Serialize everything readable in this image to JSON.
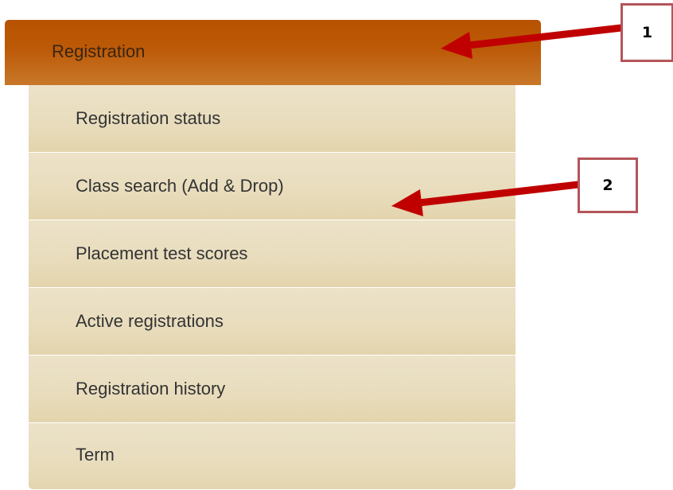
{
  "menu": {
    "header_label": "Registration",
    "items": [
      {
        "label": "Registration status"
      },
      {
        "label": "Class search (Add & Drop)"
      },
      {
        "label": "Placement test scores"
      },
      {
        "label": "Active registrations"
      },
      {
        "label": "Registration history"
      },
      {
        "label": "Term"
      }
    ]
  },
  "annotations": {
    "callout_1": "1",
    "callout_2": "2",
    "arrow_color": "#c00000",
    "box_border_color": "#b5555a"
  },
  "colors": {
    "header_bg": "#b85200",
    "item_bg": "#e8dcbc"
  }
}
